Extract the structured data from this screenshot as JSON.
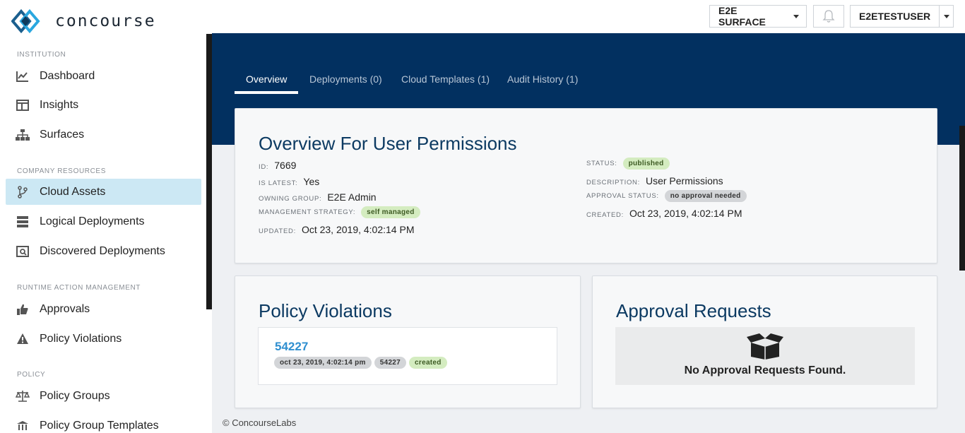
{
  "app": {
    "brand": "concourse"
  },
  "header": {
    "surface_label": "E2E SURFACE",
    "user_label": "E2ETESTUSER"
  },
  "sidebar": {
    "sections": [
      {
        "title": "INSTITUTION",
        "items": [
          {
            "label": "Dashboard",
            "icon": "chart-line-icon"
          },
          {
            "label": "Insights",
            "icon": "columns-icon"
          },
          {
            "label": "Surfaces",
            "icon": "sitemap-icon"
          }
        ]
      },
      {
        "title": "COMPANY RESOURCES",
        "items": [
          {
            "label": "Cloud Assets",
            "icon": "git-branch-icon",
            "active": true
          },
          {
            "label": "Logical Deployments",
            "icon": "server-icon"
          },
          {
            "label": "Discovered Deployments",
            "icon": "search-list-icon"
          }
        ]
      },
      {
        "title": "RUNTIME ACTION MANAGEMENT",
        "items": [
          {
            "label": "Approvals",
            "icon": "thumbs-up-icon"
          },
          {
            "label": "Policy Violations",
            "icon": "warning-icon"
          }
        ]
      },
      {
        "title": "POLICY",
        "items": [
          {
            "label": "Policy Groups",
            "icon": "scale-icon"
          },
          {
            "label": "Policy Group Templates",
            "icon": "institution-icon"
          }
        ]
      }
    ]
  },
  "tabs": [
    {
      "label": "Overview",
      "active": true
    },
    {
      "label": "Deployments (0)"
    },
    {
      "label": "Cloud Templates (1)"
    },
    {
      "label": "Audit History (1)"
    }
  ],
  "overview": {
    "title": "Overview For User Permissions",
    "left": {
      "id": {
        "key": "ID:",
        "value": "7669"
      },
      "is_latest": {
        "key": "IS LATEST:",
        "value": "Yes"
      },
      "owning_group": {
        "key": "OWNING GROUP:",
        "value": "E2E Admin"
      },
      "management_strategy": {
        "key": "MANAGEMENT STRATEGY:",
        "value": "self managed"
      },
      "updated": {
        "key": "UPDATED:",
        "value": "Oct 23, 2019, 4:02:14 PM"
      }
    },
    "right": {
      "status": {
        "key": "STATUS:",
        "value": "published"
      },
      "description": {
        "key": "DESCRIPTION:",
        "value": "User Permissions"
      },
      "approval_status": {
        "key": "APPROVAL STATUS:",
        "value": "no approval needed"
      },
      "created": {
        "key": "CREATED:",
        "value": "Oct 23, 2019, 4:02:14 PM"
      }
    }
  },
  "policy_violations": {
    "title": "Policy Violations",
    "items": [
      {
        "id": "54227",
        "date": "oct 23, 2019, 4:02:14 pm",
        "tag": "54227",
        "state": "created"
      }
    ]
  },
  "approval_requests": {
    "title": "Approval Requests",
    "empty_text": "No Approval Requests Found.",
    "empty_icon": "open-box-icon"
  },
  "footer": {
    "text": "© ConcourseLabs"
  },
  "colors": {
    "banner": "#023060",
    "active_nav": "#cce8f4",
    "title": "#0c3a62",
    "link": "#2f8fd0",
    "pill_green": "#d4ecc0",
    "pill_grey": "#d3d5d8"
  }
}
